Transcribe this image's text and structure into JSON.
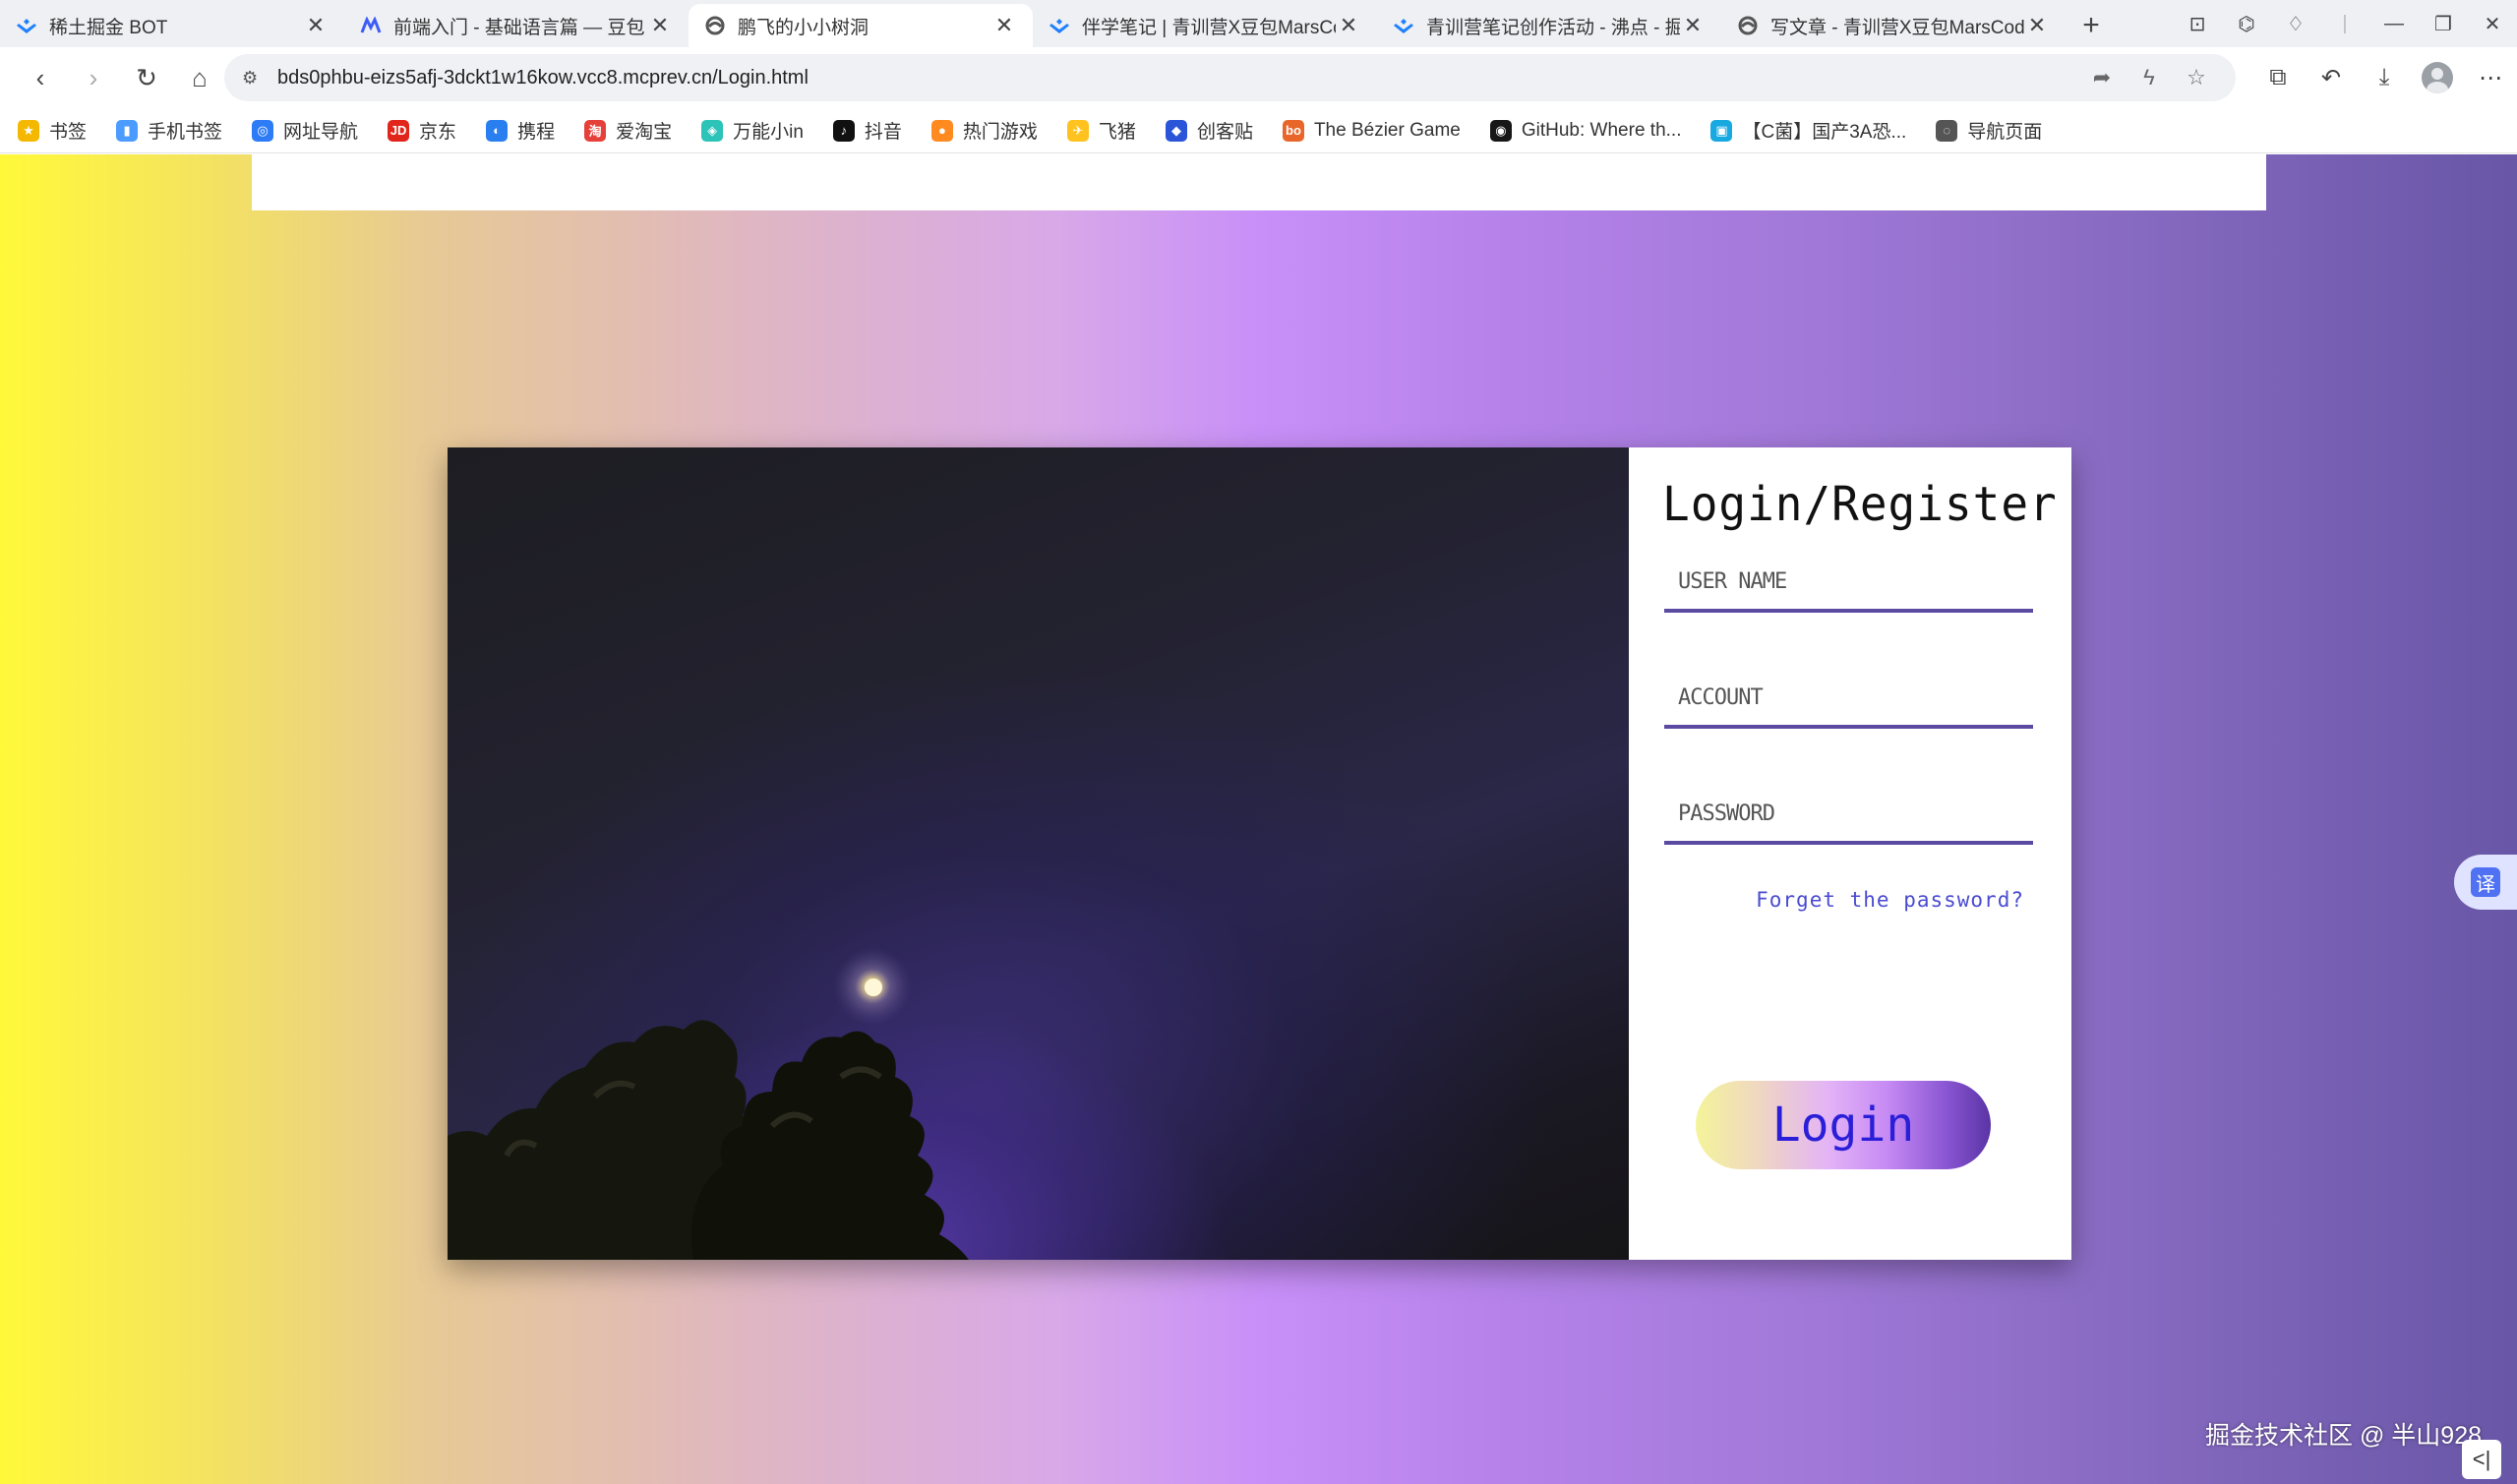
{
  "tabs": [
    {
      "title": "稀土掘金 BOT",
      "icon": "juejin-icon",
      "active": false
    },
    {
      "title": "前端入门 - 基础语言篇 — 豆包 MarsCode",
      "icon": "marscode-icon",
      "active": false
    },
    {
      "title": "鹏飞的小小树洞",
      "icon": "edge-icon",
      "active": true
    },
    {
      "title": "伴学笔记 | 青训营X豆包MarsCode",
      "icon": "juejin-icon",
      "active": false
    },
    {
      "title": "青训营笔记创作活动 - 沸点 - 掘金",
      "icon": "juejin-icon",
      "active": false
    },
    {
      "title": "写文章 - 青训营X豆包MarsCode",
      "icon": "edge-icon",
      "active": false
    }
  ],
  "address": {
    "url": "bds0phbu-eizs5afj-3dckt1w16kow.vcc8.mcprev.cn/Login.html"
  },
  "bookmarks": [
    {
      "label": "书签",
      "color": "#f5b800",
      "glyph": "★"
    },
    {
      "label": "手机书签",
      "color": "#4c9bff",
      "glyph": "▮"
    },
    {
      "label": "网址导航",
      "color": "#2d7cf6",
      "glyph": "◎"
    },
    {
      "label": "京东",
      "color": "#e1251b",
      "glyph": "JD"
    },
    {
      "label": "携程",
      "color": "#2a7ff0",
      "glyph": "◐"
    },
    {
      "label": "爱淘宝",
      "color": "#e5403a",
      "glyph": "淘"
    },
    {
      "label": "万能小in",
      "color": "#2cc3b8",
      "glyph": "◈"
    },
    {
      "label": "抖音",
      "color": "#111111",
      "glyph": "♪"
    },
    {
      "label": "热门游戏",
      "color": "#ff8a1f",
      "glyph": "●"
    },
    {
      "label": "飞猪",
      "color": "#ffc21f",
      "glyph": "✈"
    },
    {
      "label": "创客贴",
      "color": "#2b55d9",
      "glyph": "◆"
    },
    {
      "label": "The Bézier Game",
      "color": "#e8662a",
      "glyph": "bo"
    },
    {
      "label": "GitHub: Where th...",
      "color": "#181717",
      "glyph": "◉"
    },
    {
      "label": "【C菌】国产3A恐...",
      "color": "#18a9e1",
      "glyph": "▣"
    },
    {
      "label": "导航页面",
      "color": "#555555",
      "glyph": "◌"
    }
  ],
  "login": {
    "title": "Login/Register",
    "username_placeholder": "USER NAME",
    "account_placeholder": "ACCOUNT",
    "password_placeholder": "PASSWORD",
    "forgot": "Forget the password?",
    "button": "Login"
  },
  "translate": {
    "label": "译"
  },
  "watermark": "掘金技术社区 @ 半山928",
  "collapse": {
    "label": "<|"
  }
}
